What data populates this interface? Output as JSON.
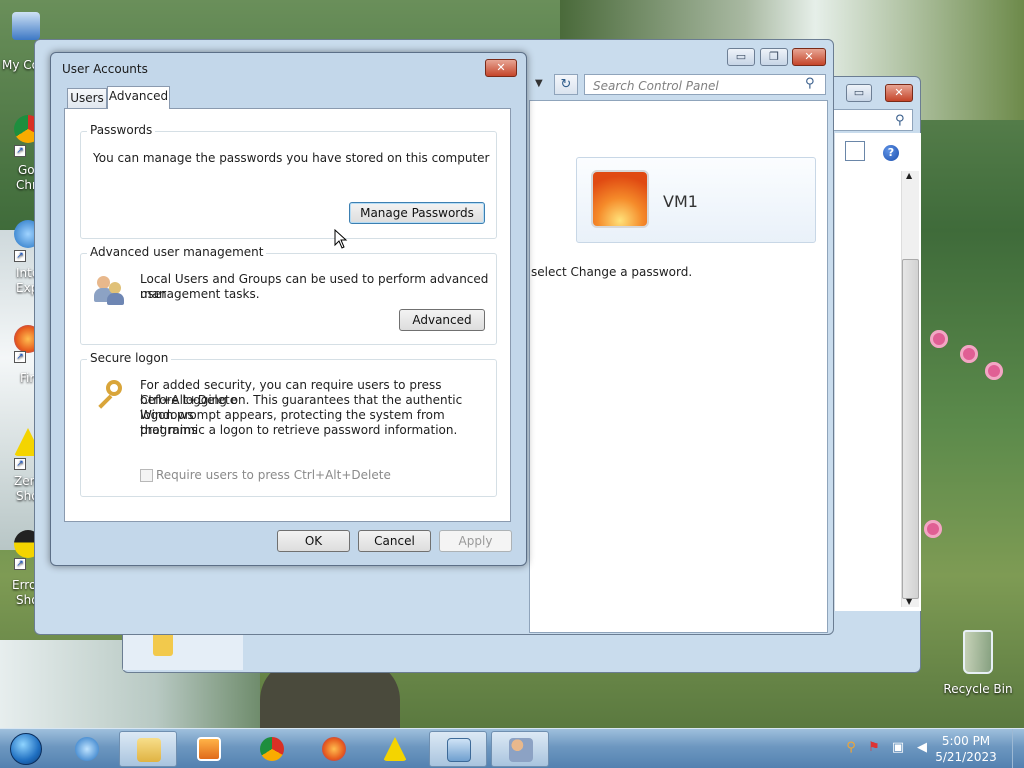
{
  "desktop": {
    "icons": [
      {
        "label": "My Co",
        "label2": ""
      },
      {
        "label": "Go",
        "label2": "Chr"
      },
      {
        "label": "Inte",
        "label2": "Exp"
      },
      {
        "label": "Fir",
        "label2": ""
      },
      {
        "label": "Zen",
        "label2": "Sho"
      },
      {
        "label": "Erro",
        "label2": "Sho"
      }
    ],
    "recycle_bin": "Recycle Bin"
  },
  "control_panel": {
    "search_placeholder": "Search Control Panel",
    "account_name": "VM1",
    "partial_text": "select Change a password."
  },
  "dialog": {
    "title": "User Accounts",
    "tabs": [
      "Users",
      "Advanced"
    ],
    "active_tab": "Advanced",
    "passwords": {
      "caption": "Passwords",
      "text": "You can manage the passwords you have stored on this computer",
      "button": "Manage Passwords"
    },
    "advanced_mgmt": {
      "caption": "Advanced user management",
      "line1": "Local Users and Groups can be used to perform advanced user",
      "line2": "management tasks.",
      "button": "Advanced"
    },
    "secure_logon": {
      "caption": "Secure logon",
      "line1": "For added security, you can require users to press Ctrl+Alt+Delete",
      "line2": "before logging on. This guarantees that the authentic Windows",
      "line3": "logon prompt appears, protecting the system from programs",
      "line4": "that mimic a logon to retrieve password information.",
      "checkbox_label": "Require users to press Ctrl+Alt+Delete",
      "checked": false
    },
    "buttons": {
      "ok": "OK",
      "cancel": "Cancel",
      "apply": "Apply"
    }
  },
  "taskbar": {
    "items": [
      "start-orb",
      "internet-explorer",
      "file-explorer",
      "media-player",
      "chrome",
      "firefox",
      "warning-app",
      "control-panel",
      "user-accounts"
    ],
    "time": "5:00 PM",
    "date": "5/21/2023"
  },
  "colors": {
    "window_frame": "#c3d7ea",
    "focus_border": "#3c7fb1",
    "close_button": "#c5452a"
  }
}
